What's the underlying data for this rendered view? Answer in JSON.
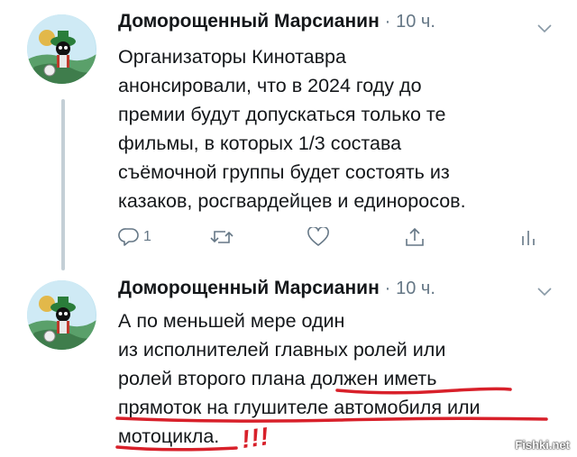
{
  "tweets": [
    {
      "author": "Доморощенный Марсианин",
      "separator": "·",
      "time": "10 ч.",
      "avatar_icon": "marvin-the-martian-avatar",
      "lines": [
        "Организаторы Кинотавра",
        "анонсировали, что в 2024 году до",
        "премии будут допускаться только те",
        "фильмы, в которых 1/3 состава",
        "съёмочной группы будет состоять из",
        "казаков, росгвардейцев и единоросов."
      ],
      "actions": {
        "reply_count": "1",
        "reply_icon": "reply-icon",
        "retweet_icon": "retweet-icon",
        "like_icon": "heart-icon",
        "share_icon": "share-icon",
        "analytics_icon": "analytics-icon"
      }
    },
    {
      "author": "Доморощенный Марсианин",
      "separator": "·",
      "time": "10 ч.",
      "avatar_icon": "marvin-the-martian-avatar",
      "lines": [
        "А по меньшей мере один",
        "из исполнителей главных ролей или",
        "ролей второго плана должен иметь",
        "прямоток на глушителе автомобиля или",
        "мотоцикла."
      ],
      "annotation": "!!!"
    }
  ],
  "watermark": "Fishki.net",
  "colors": {
    "text": "#14171a",
    "meta": "#657786",
    "thread_line": "#c4cfd6",
    "annotation_red": "#d8202a"
  }
}
